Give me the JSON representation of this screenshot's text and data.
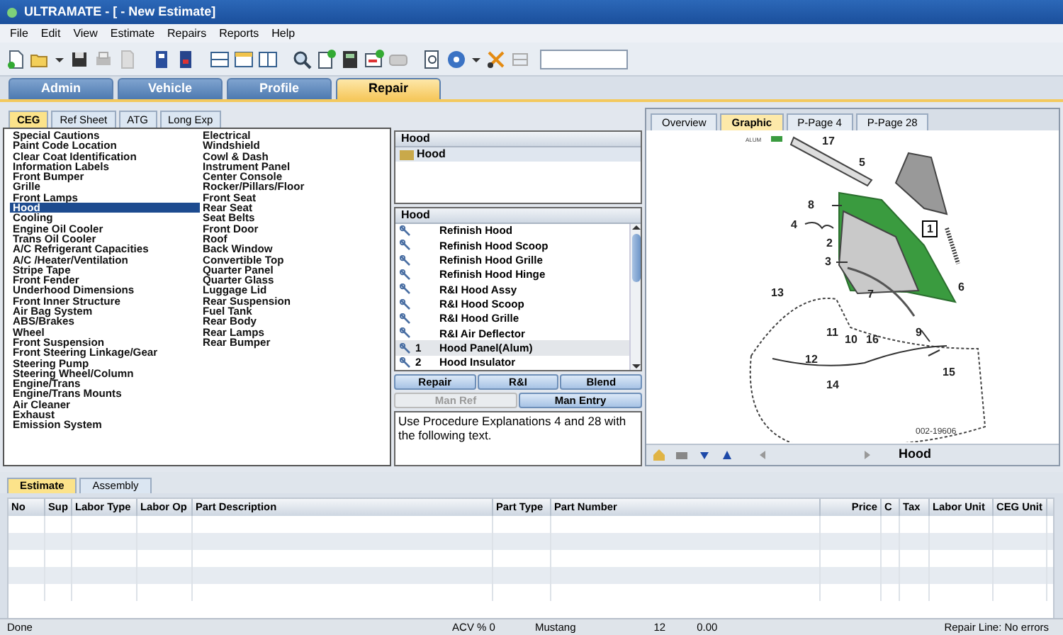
{
  "window": {
    "title": "ULTRAMATE - [ - New Estimate]"
  },
  "menu": [
    "File",
    "Edit",
    "View",
    "Estimate",
    "Repairs",
    "Reports",
    "Help"
  ],
  "main_tabs": [
    {
      "label": "Admin",
      "selected": false
    },
    {
      "label": "Vehicle",
      "selected": false
    },
    {
      "label": "Profile",
      "selected": false
    },
    {
      "label": "Repair",
      "selected": true
    }
  ],
  "ceg_panel": {
    "tabs": [
      {
        "label": "CEG",
        "selected": true
      },
      {
        "label": "Ref Sheet",
        "selected": false
      },
      {
        "label": "ATG",
        "selected": false
      },
      {
        "label": "Long Exp",
        "selected": false
      }
    ],
    "sections": [
      [
        {
          "label": "Special Cautions",
          "selected": false
        },
        {
          "label": "Paint Code Location",
          "selected": false
        },
        {
          "label": "Clear Coat Identification",
          "selected": false
        },
        {
          "label": "Information Labels",
          "selected": false
        },
        {
          "label": "Front Bumper",
          "selected": false
        },
        {
          "label": "Grille",
          "selected": false
        },
        {
          "label": "Front Lamps",
          "selected": false
        },
        {
          "label": "Hood",
          "selected": true
        },
        {
          "label": "Cooling",
          "selected": false
        },
        {
          "label": "Engine Oil Cooler",
          "selected": false
        },
        {
          "label": "Trans Oil Cooler",
          "selected": false
        },
        {
          "label": "A/C Refrigerant Capacities",
          "selected": false
        },
        {
          "label": "A/C /Heater/Ventilation",
          "selected": false
        },
        {
          "label": "Stripe Tape",
          "selected": false
        },
        {
          "label": "Front Fender",
          "selected": false
        },
        {
          "label": "Underhood Dimensions",
          "selected": false
        },
        {
          "label": "Front Inner Structure",
          "selected": false
        },
        {
          "label": "Air Bag System",
          "selected": false
        },
        {
          "label": "ABS/Brakes",
          "selected": false
        },
        {
          "label": "Wheel",
          "selected": false
        },
        {
          "label": "Front Suspension",
          "selected": false
        },
        {
          "label": "Front Steering Linkage/Gear",
          "selected": false
        },
        {
          "label": "Steering Pump",
          "selected": false
        },
        {
          "label": "Steering Wheel/Column",
          "selected": false
        },
        {
          "label": "Engine/Trans",
          "selected": false
        },
        {
          "label": "Engine/Trans Mounts",
          "selected": false
        },
        {
          "label": "Air Cleaner",
          "selected": false
        },
        {
          "label": "Exhaust",
          "selected": false
        },
        {
          "label": "Emission System",
          "selected": false
        }
      ],
      [
        {
          "label": "Electrical",
          "selected": false
        },
        {
          "label": "Windshield",
          "selected": false
        },
        {
          "label": "Cowl & Dash",
          "selected": false
        },
        {
          "label": "Instrument Panel",
          "selected": false
        },
        {
          "label": "Center Console",
          "selected": false
        },
        {
          "label": "Rocker/Pillars/Floor",
          "selected": false
        },
        {
          "label": "Front Seat",
          "selected": false
        },
        {
          "label": "Rear Seat",
          "selected": false
        },
        {
          "label": "Seat Belts",
          "selected": false
        },
        {
          "label": "Front Door",
          "selected": false
        },
        {
          "label": "Roof",
          "selected": false
        },
        {
          "label": "Back Window",
          "selected": false
        },
        {
          "label": "Convertible Top",
          "selected": false
        },
        {
          "label": "Quarter Panel",
          "selected": false
        },
        {
          "label": "Quarter Glass",
          "selected": false
        },
        {
          "label": "Luggage Lid",
          "selected": false
        },
        {
          "label": "Rear Suspension",
          "selected": false
        },
        {
          "label": "Fuel Tank",
          "selected": false
        },
        {
          "label": "Rear Body",
          "selected": false
        },
        {
          "label": "Rear Lamps",
          "selected": false
        },
        {
          "label": "Rear Bumper",
          "selected": false
        }
      ]
    ]
  },
  "operations_panel": {
    "group_header": "Hood",
    "groups": [
      {
        "label": "Hood",
        "selected": true
      }
    ],
    "operations_header": "Hood",
    "operations": [
      {
        "label": "Refinish Hood",
        "selected": false
      },
      {
        "label": "Refinish Hood Scoop",
        "selected": false
      },
      {
        "label": "Refinish Hood Grille",
        "selected": false
      },
      {
        "label": "Refinish Hood Hinge",
        "selected": false
      },
      {
        "label": "R&I Hood Assy",
        "selected": false
      },
      {
        "label": "R&I Hood Scoop",
        "selected": false
      },
      {
        "label": "R&I Hood Grille",
        "selected": false
      },
      {
        "label": "R&I Air Deflector",
        "selected": false
      },
      {
        "number": "1",
        "label": "Hood Panel(Alum)",
        "selected": true
      },
      {
        "number": "2",
        "label": "Hood Insulator",
        "selected": false
      }
    ],
    "buttons": [
      {
        "label": "Repair",
        "disabled": false
      },
      {
        "label": "R&I",
        "disabled": false
      },
      {
        "label": "Blend",
        "disabled": false
      },
      {
        "label": "Man Ref",
        "disabled": true
      },
      {
        "label": "Man Entry",
        "disabled": false
      }
    ],
    "note": "Use Procedure Explanations 4 and 28 with the following text."
  },
  "graphic_panel": {
    "tabs": [
      {
        "label": "Overview",
        "selected": false
      },
      {
        "label": "Graphic",
        "selected": true
      },
      {
        "label": "P-Page 4",
        "selected": false
      },
      {
        "label": "P-Page 28",
        "selected": false
      }
    ],
    "legend": "ALUM",
    "callouts": [
      {
        "label": "17",
        "kind": "plain"
      },
      {
        "label": "5",
        "kind": "plain"
      },
      {
        "label": "8",
        "kind": "plain"
      },
      {
        "label": "4",
        "kind": "plain"
      },
      {
        "label": "2",
        "kind": "plain"
      },
      {
        "label": "3",
        "kind": "plain"
      },
      {
        "label": "1",
        "kind": "boxed"
      },
      {
        "label": "6",
        "kind": "plain"
      },
      {
        "label": "7",
        "kind": "plain"
      },
      {
        "label": "13",
        "kind": "plain"
      },
      {
        "label": "11",
        "kind": "plain"
      },
      {
        "label": "10",
        "kind": "plain"
      },
      {
        "label": "16",
        "kind": "plain"
      },
      {
        "label": "9",
        "kind": "plain"
      },
      {
        "label": "12",
        "kind": "plain"
      },
      {
        "label": "14",
        "kind": "plain"
      },
      {
        "label": "15",
        "kind": "plain"
      }
    ],
    "figure_code": "002-19606",
    "caption": "Hood"
  },
  "estimate": {
    "tabs": [
      {
        "label": "Estimate",
        "selected": true
      },
      {
        "label": "Assembly",
        "selected": false
      }
    ],
    "columns": [
      "No",
      "Sup",
      "Labor Type",
      "Labor Op",
      "Part Description",
      "Part Type",
      "Part Number",
      "Price",
      "C",
      "Tax",
      "Labor Unit",
      "CEG Unit"
    ]
  },
  "status_bar": [
    "Done",
    "ACV % 0",
    "Mustang",
    "12",
    "0.00",
    "Repair Line: No errors"
  ]
}
